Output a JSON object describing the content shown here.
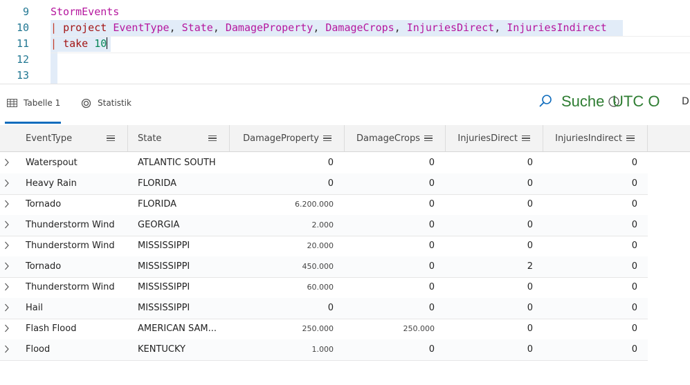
{
  "editor": {
    "lines": [
      {
        "num": "9"
      },
      {
        "num": "10"
      },
      {
        "num": "11"
      },
      {
        "num": "12"
      },
      {
        "num": "13"
      }
    ],
    "line9_table": "StormEvents",
    "line10_pipe": "|",
    "line10_kw": "project",
    "line10_cols": [
      "EventType",
      "State",
      "DamageProperty",
      "DamageCrops",
      "InjuriesDirect",
      "InjuriesIndirect"
    ],
    "line11_pipe": "|",
    "line11_kw": "take",
    "line11_num": "10"
  },
  "tabs": [
    {
      "label": "Tabelle 1",
      "icon": "table-icon",
      "active": true
    },
    {
      "label": "Statistik",
      "icon": "stats-icon",
      "active": false
    }
  ],
  "toolbar": {
    "search_label": "Suche",
    "utc_label": "UTC O",
    "d_label": "D"
  },
  "colors": {
    "accent": "#0f6cbd",
    "keyword": "#a31515",
    "identifier": "#b5179e",
    "number": "#098658",
    "line_number": "#237893",
    "toolbar_text": "#2e7d32"
  },
  "grid": {
    "columns": [
      "EventType",
      "State",
      "DamageProperty",
      "DamageCrops",
      "InjuriesDirect",
      "InjuriesIndirect"
    ],
    "rows": [
      [
        "Waterspout",
        "ATLANTIC SOUTH",
        "0",
        "0",
        "0",
        "0"
      ],
      [
        "Heavy Rain",
        "FLORIDA",
        "0",
        "0",
        "0",
        "0"
      ],
      [
        "Tornado",
        "FLORIDA",
        "6.200.000",
        "0",
        "0",
        "0"
      ],
      [
        "Thunderstorm Wind",
        "GEORGIA",
        "2.000",
        "0",
        "0",
        "0"
      ],
      [
        "Thunderstorm Wind",
        "MISSISSIPPI",
        "20.000",
        "0",
        "0",
        "0"
      ],
      [
        "Tornado",
        "MISSISSIPPI",
        "450.000",
        "0",
        "2",
        "0"
      ],
      [
        "Thunderstorm Wind",
        "MISSISSIPPI",
        "60.000",
        "0",
        "0",
        "0"
      ],
      [
        "Hail",
        "MISSISSIPPI",
        "0",
        "0",
        "0",
        "0"
      ],
      [
        "Flash Flood",
        "AMERICAN SAM...",
        "250.000",
        "250.000",
        "0",
        "0"
      ],
      [
        "Flood",
        "KENTUCKY",
        "1.000",
        "0",
        "0",
        "0"
      ]
    ]
  }
}
